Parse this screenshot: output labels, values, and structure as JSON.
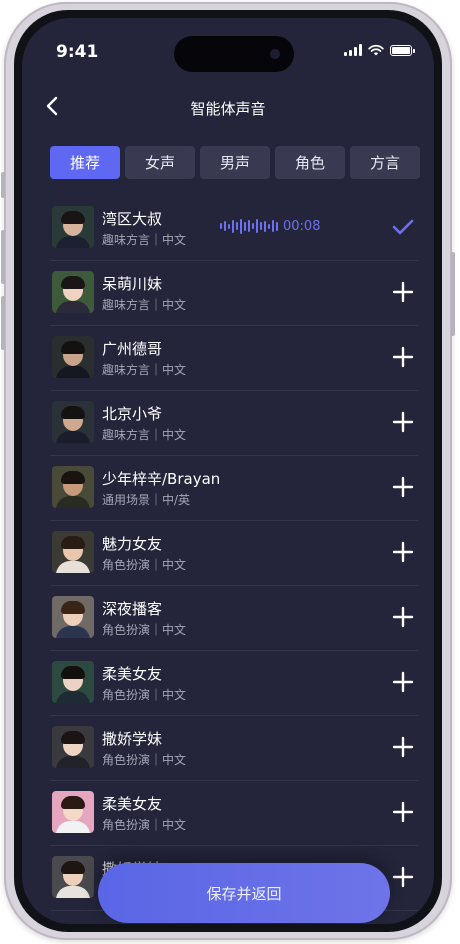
{
  "status_bar": {
    "time": "9:41"
  },
  "header": {
    "title": "智能体声音",
    "back_icon": "chevron-left-icon"
  },
  "tabs": [
    {
      "label": "推荐",
      "active": true
    },
    {
      "label": "女声",
      "active": false
    },
    {
      "label": "男声",
      "active": false
    },
    {
      "label": "角色",
      "active": false
    },
    {
      "label": "方言",
      "active": false
    }
  ],
  "voices": [
    {
      "name": "湾区大叔",
      "subtitle": "趣味方言｜中文",
      "playing": true,
      "duration": "00:08",
      "selected": true
    },
    {
      "name": "呆萌川妹",
      "subtitle": "趣味方言｜中文",
      "selected": false
    },
    {
      "name": "广州德哥",
      "subtitle": "趣味方言｜中文",
      "selected": false
    },
    {
      "name": "北京小爷",
      "subtitle": "趣味方言｜中文",
      "selected": false
    },
    {
      "name": "少年梓辛/Brayan",
      "subtitle": "通用场景｜中/英",
      "selected": false
    },
    {
      "name": "魅力女友",
      "subtitle": "角色扮演｜中文",
      "selected": false
    },
    {
      "name": "深夜播客",
      "subtitle": "角色扮演｜中文",
      "selected": false
    },
    {
      "name": "柔美女友",
      "subtitle": "角色扮演｜中文",
      "selected": false
    },
    {
      "name": "撒娇学妹",
      "subtitle": "角色扮演｜中文",
      "selected": false
    },
    {
      "name": "柔美女友",
      "subtitle": "角色扮演｜中文",
      "selected": false
    },
    {
      "name": "撒娇学妹",
      "subtitle": "",
      "selected": false
    }
  ],
  "save_button": {
    "label": "保存并返回"
  },
  "colors": {
    "accent": "#5f68f2",
    "background": "#24243a",
    "tab_inactive": "#393a52"
  }
}
